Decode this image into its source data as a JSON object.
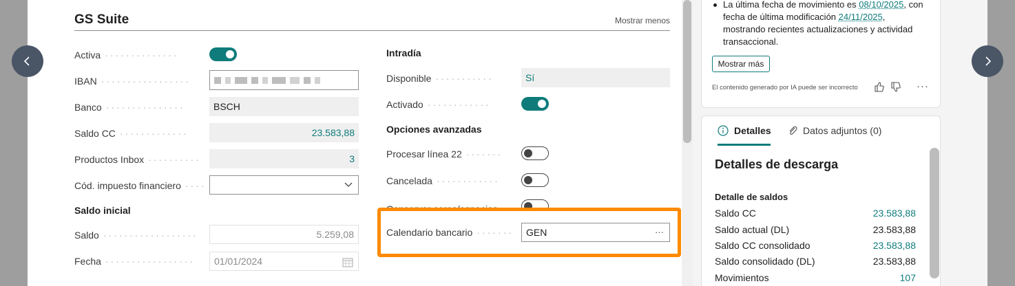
{
  "section": {
    "title": "GS Suite",
    "show_less": "Mostrar menos"
  },
  "left_fields": {
    "activa": {
      "label": "Activa",
      "value": true
    },
    "iban": {
      "label": "IBAN"
    },
    "banco": {
      "label": "Banco",
      "value": "BSCH"
    },
    "saldo_cc": {
      "label": "Saldo CC",
      "value": "23.583,88"
    },
    "productos_inbox": {
      "label": "Productos Inbox",
      "value": "3"
    },
    "cod_impuesto": {
      "label": "Cód. impuesto financiero",
      "value": ""
    }
  },
  "saldo_inicial": {
    "heading": "Saldo inicial",
    "saldo": {
      "label": "Saldo",
      "value": "5.259,08"
    },
    "fecha": {
      "label": "Fecha",
      "value": "01/01/2024"
    }
  },
  "intradia": {
    "heading": "Intradía",
    "disponible": {
      "label": "Disponible",
      "value": "Sí"
    },
    "activado": {
      "label": "Activado",
      "value": true
    }
  },
  "opciones": {
    "heading": "Opciones avanzadas",
    "procesar": {
      "label": "Procesar línea 22",
      "value": false
    },
    "cancelada": {
      "label": "Cancelada",
      "value": false
    },
    "conservar": {
      "label": "Conservar ceros/espacios",
      "value": false
    },
    "calendario": {
      "label": "Calendario bancario",
      "value": "GEN",
      "more": "···"
    }
  },
  "ai_summary": {
    "text_prefix": "La última fecha de movimiento es ",
    "date1": "08/10/2025",
    "text_mid": ", con fecha de última modificación ",
    "date2": "24/11/2025",
    "text_suffix": ", mostrando recientes actualizaciones y actividad transaccional.",
    "more_button": "Mostrar más",
    "disclaimer": "El contenido generado por IA puede ser incorrecto",
    "menu": "···"
  },
  "details_panel": {
    "tabs": [
      {
        "label": "Detalles",
        "icon": "info-icon"
      },
      {
        "label": "Datos adjuntos (0)",
        "icon": "paperclip-icon"
      }
    ],
    "title": "Detalles de descarga",
    "subheading": "Detalle de saldos",
    "rows": [
      {
        "label": "Saldo CC",
        "value": "23.583,88",
        "link": true
      },
      {
        "label": "Saldo actual (DL)",
        "value": "23.583,88",
        "link": false
      },
      {
        "label": "Saldo CC consolidado",
        "value": "23.583,88",
        "link": true
      },
      {
        "label": "Saldo consolidado (DL)",
        "value": "23.583,88",
        "link": false
      },
      {
        "label": "Movimientos",
        "value": "107",
        "link": true
      }
    ]
  },
  "colors": {
    "accent": "#0f7b7b",
    "highlight": "#ff8a00",
    "nav": "#4a5566"
  }
}
